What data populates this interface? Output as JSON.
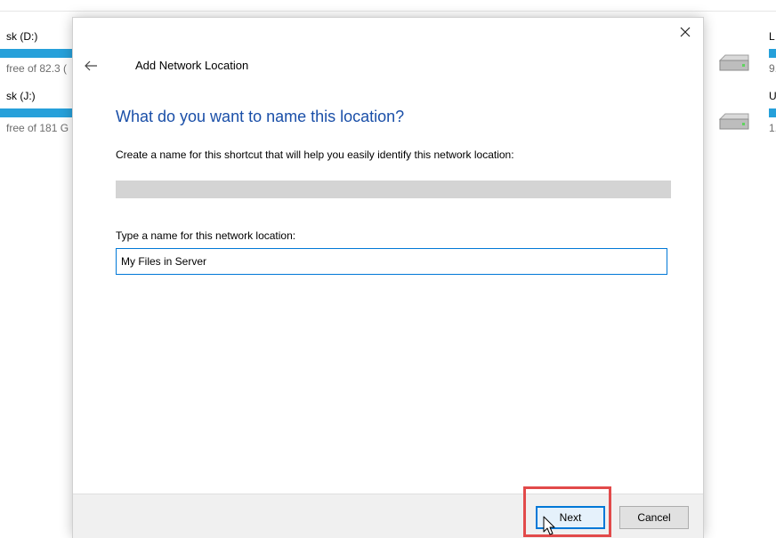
{
  "background": {
    "left_drives": [
      {
        "label": "sk (D:)",
        "free_text": "free of 82.3 (",
        "fill_percent": 100
      },
      {
        "label": "sk (J:)",
        "free_text": "free of 181 G",
        "fill_percent": 100
      }
    ],
    "right_drives": [
      {
        "label": "L",
        "free_text": "9."
      },
      {
        "label": "U",
        "free_text": "1."
      }
    ]
  },
  "dialog": {
    "title": "Add Network Location",
    "heading": "What do you want to name this location?",
    "description": "Create a name for this shortcut that will help you easily identify this network location:",
    "field_label": "Type a name for this network location:",
    "name_value": "My Files in Server",
    "next_label": "Next",
    "cancel_label": "Cancel",
    "icons": {
      "close": "close-icon",
      "back": "back-arrow-icon",
      "drive": "hard-drive-icon",
      "cursor": "mouse-cursor-icon"
    }
  },
  "colors": {
    "heading": "#1a4fa8",
    "accent": "#0078d7",
    "drive_bar": "#26a0da",
    "highlight": "#e24a4a"
  }
}
